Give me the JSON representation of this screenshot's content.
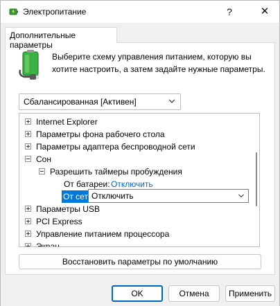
{
  "window": {
    "title": "Электропитание",
    "help_label": "?",
    "close_label": "✕"
  },
  "tab": {
    "label": "Дополнительные параметры"
  },
  "intro": {
    "text": "Выберите схему управления питанием, которую вы хотите настроить, а затем задайте нужные параметры."
  },
  "scheme": {
    "selected": "Сбалансированная [Активен]"
  },
  "tree": {
    "items": [
      {
        "label": "Internet Explorer",
        "expanded": false
      },
      {
        "label": "Параметры фона рабочего стола",
        "expanded": false
      },
      {
        "label": "Параметры адаптера беспроводной сети",
        "expanded": false
      },
      {
        "label": "Сон",
        "expanded": true
      },
      {
        "label": "Разрешить таймеры пробуждения",
        "expanded": true
      },
      {
        "label": "От батареи:",
        "value": "Отключить"
      },
      {
        "label": "От сети:",
        "value": "Отключить"
      },
      {
        "label": "Параметры USB",
        "expanded": false
      },
      {
        "label": "PCI Express",
        "expanded": false
      },
      {
        "label": "Управление питанием процессора",
        "expanded": false
      },
      {
        "label": "Экран",
        "expanded": false
      }
    ]
  },
  "buttons": {
    "restore": "Восстановить параметры по умолчанию",
    "ok": "OK",
    "cancel": "Отмена",
    "apply": "Применить"
  },
  "colors": {
    "accent": "#0078d7",
    "link": "#0066cc",
    "battery_green": "#3cb043"
  },
  "icons": {
    "app": "power-options-icon",
    "battery": "battery-plug-icon"
  }
}
